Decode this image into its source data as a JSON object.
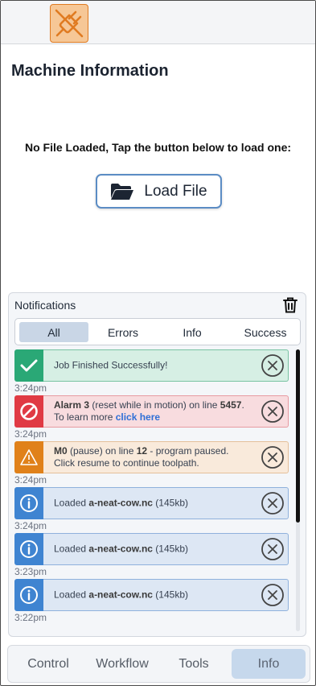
{
  "header": {
    "connection_icon": "plug-disconnected-icon",
    "accent": "#e07b21"
  },
  "page": {
    "title": "Machine Information"
  },
  "file": {
    "status_text": "No File Loaded, Tap the button below to load one:",
    "load_button_label": "Load File",
    "load_button_icon": "folder-open-icon"
  },
  "notifications": {
    "title": "Notifications",
    "clear_icon": "trash-icon",
    "filters": [
      {
        "label": "All",
        "active": true
      },
      {
        "label": "Errors",
        "active": false
      },
      {
        "label": "Info",
        "active": false
      },
      {
        "label": "Success",
        "active": false
      }
    ],
    "items": [
      {
        "type": "success",
        "icon": "check-icon",
        "text": "Job Finished Successfully!",
        "time": "3:24pm"
      },
      {
        "type": "error",
        "icon": "prohibited-icon",
        "bold1": "Alarm 3",
        "text1": " (reset while in motion) on line ",
        "bold2": "5457",
        "text2": ".",
        "line2": "To learn more ",
        "link": "click here",
        "time": "3:24pm"
      },
      {
        "type": "warning",
        "icon": "warning-icon",
        "bold1": "M0",
        "text1": " (pause) on line ",
        "bold2": "12",
        "text2": " - program paused.",
        "line2": "Click resume to continue toolpath.",
        "time": "3:24pm"
      },
      {
        "type": "info",
        "icon": "info-icon",
        "prefix": "Loaded ",
        "file": "a-neat-cow.nc",
        "suffix": " (145kb)",
        "time": "3:24pm"
      },
      {
        "type": "info",
        "icon": "info-icon",
        "prefix": "Loaded ",
        "file": "a-neat-cow.nc",
        "suffix": " (145kb)",
        "time": "3:23pm"
      },
      {
        "type": "info",
        "icon": "info-icon",
        "prefix": "Loaded ",
        "file": "a-neat-cow.nc",
        "suffix": " (145kb)",
        "time": "3:22pm"
      }
    ],
    "colors": {
      "success": "#2aa876",
      "error": "#e03a44",
      "warning": "#e0811a",
      "info": "#3f84d1"
    }
  },
  "nav": {
    "tabs": [
      {
        "label": "Control",
        "active": false
      },
      {
        "label": "Workflow",
        "active": false
      },
      {
        "label": "Tools",
        "active": false
      },
      {
        "label": "Info",
        "active": true
      }
    ]
  }
}
